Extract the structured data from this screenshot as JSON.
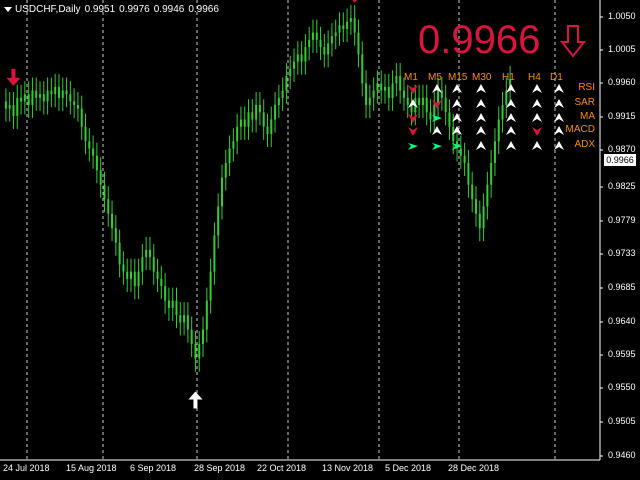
{
  "header": {
    "symbol": "USDCHF,Daily",
    "open": "0.9951",
    "high": "0.9976",
    "low": "0.9946",
    "close": "0.9966"
  },
  "big_price": "0.9966",
  "current_price_tag": "0.9966",
  "colors": {
    "background": "#000000",
    "bull_candle": "#32cd32",
    "bear_candle": "#32cd32",
    "grid": "#ffffff",
    "sell_arrow": "#dc143c",
    "buy_arrow": "#ffffff",
    "indicator_label": "#ff8c00",
    "signal_up": "#ffffff",
    "signal_down": "#dc143c",
    "signal_green": "#00ff7f"
  },
  "y_axis_labels": [
    "1.0050",
    "1.0005",
    "0.9960",
    "0.9915",
    "0.9870",
    "0.9825",
    "0.9779",
    "0.9733",
    "0.9685",
    "0.9640",
    "0.9595",
    "0.9550",
    "0.9505",
    "0.9460"
  ],
  "x_axis_labels": [
    "24 Jul 2018",
    "15 Aug 2018",
    "6 Sep 2018",
    "28 Sep 2018",
    "22 Oct 2018",
    "13 Nov 2018",
    "5 Dec 2018",
    "28 Dec 2018"
  ],
  "dashboard": {
    "timeframes": [
      "M1",
      "M5",
      "M15",
      "M30",
      "H1",
      "H4",
      "D1"
    ],
    "indicators": [
      "RSI",
      "SAR",
      "MA",
      "MACD",
      "ADX"
    ],
    "signals": [
      [
        "down",
        "up",
        "up",
        "up",
        "up",
        "up",
        "up"
      ],
      [
        "up",
        "down",
        "up",
        "up",
        "up",
        "up",
        "up"
      ],
      [
        "down",
        "green",
        "up",
        "up",
        "up",
        "up",
        "up"
      ],
      [
        "down",
        "up",
        "up",
        "up",
        "up",
        "down",
        "up"
      ],
      [
        "green",
        "green",
        "green",
        "up",
        "up",
        "up",
        "up"
      ]
    ]
  },
  "chart_data": {
    "type": "candlestick",
    "symbol": "USDCHF",
    "period": "Daily",
    "ylim": [
      0.944,
      1.0075
    ],
    "close": [
      0.9925,
      0.993,
      0.9915,
      0.994,
      0.9935,
      0.9945,
      0.993,
      0.995,
      0.994,
      0.9945,
      0.9935,
      0.995,
      0.9945,
      0.9955,
      0.994,
      0.995,
      0.9945,
      0.9935,
      0.993,
      0.9925,
      0.99,
      0.988,
      0.987,
      0.986,
      0.984,
      0.982,
      0.98,
      0.978,
      0.976,
      0.974,
      0.971,
      0.97,
      0.969,
      0.97,
      0.968,
      0.97,
      0.972,
      0.973,
      0.972,
      0.97,
      0.969,
      0.968,
      0.966,
      0.965,
      0.966,
      0.964,
      0.963,
      0.964,
      0.962,
      0.96,
      0.958,
      0.96,
      0.962,
      0.966,
      0.97,
      0.975,
      0.979,
      0.983,
      0.985,
      0.987,
      0.988,
      0.99,
      0.991,
      0.99,
      0.992,
      0.991,
      0.993,
      0.992,
      0.99,
      0.989,
      0.991,
      0.993,
      0.994,
      0.995,
      0.997,
      0.998,
      0.999,
      1.0,
      0.999,
      1.001,
      1.002,
      1.003,
      1.002,
      1.001,
      1.0,
      1.0015,
      1.0025,
      1.003,
      1.004,
      1.0035,
      1.0045,
      1.005,
      1.003,
      1.0,
      0.996,
      0.993,
      0.994,
      0.995,
      0.996,
      0.995,
      0.9955,
      0.994,
      0.996,
      0.997,
      0.995,
      0.994,
      0.993,
      0.992,
      0.994,
      0.993,
      0.994,
      0.992,
      0.991,
      0.993,
      0.995,
      0.994,
      0.992,
      0.99,
      0.988,
      0.987,
      0.986,
      0.985,
      0.982,
      0.98,
      0.978,
      0.976,
      0.979,
      0.982,
      0.985,
      0.988,
      0.991,
      0.993,
      0.995,
      0.9966
    ],
    "signals": [
      {
        "type": "sell",
        "bar_index": 2
      },
      {
        "type": "buy",
        "bar_index": 50
      },
      {
        "type": "sell",
        "bar_index": 92
      }
    ],
    "current_price": 0.9966
  }
}
